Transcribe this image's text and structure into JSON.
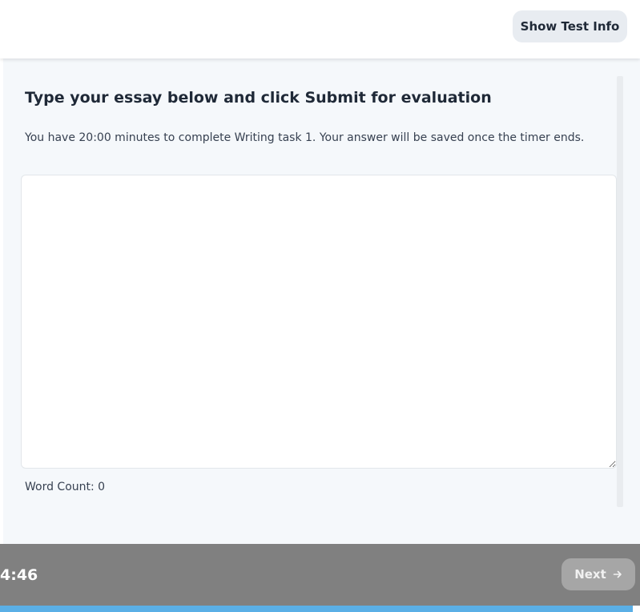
{
  "header": {
    "info_button_label": "Show Test Info"
  },
  "main": {
    "title": "Type your essay below and click Submit for evaluation",
    "instructions": "You have 20:00 minutes to complete Writing task 1. Your answer will be saved once the timer ends.",
    "essay_value": "",
    "word_count_label": "Word Count: 0"
  },
  "footer": {
    "timer": "4:46",
    "next_label": "Next",
    "next_icon": "arrow-right-icon"
  },
  "progress": {
    "fraction": 0.989
  },
  "colors": {
    "footer_bg": "#808080",
    "progress_fill": "#5aafe6",
    "panel_bg": "#f5f8fb"
  }
}
